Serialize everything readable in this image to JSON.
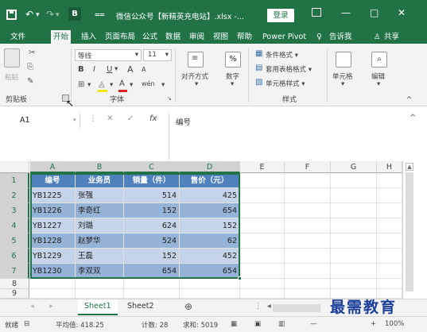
{
  "titlebar": {
    "undo_icon": "undo-icon",
    "redo_icon": "redo-icon",
    "app_badge": "B",
    "title": "微信公众号【新精英充电站】.xlsx -...",
    "login": "登录",
    "ribbon_opts_icon": "ribbon-display-icon",
    "minimize": "—",
    "maximize": "□",
    "close": "✕"
  },
  "tabs": {
    "items": [
      "文件",
      "开始",
      "插入",
      "页面布局",
      "公式",
      "数据",
      "审阅",
      "视图",
      "帮助",
      "Power Pivot"
    ],
    "active": "开始",
    "tell_me": "告诉我",
    "share": "共享"
  },
  "ribbon": {
    "clipboard": {
      "paste": "粘贴",
      "label": "剪贴板"
    },
    "font": {
      "name": "等线",
      "size": "11",
      "bold": "B",
      "italic": "I",
      "underline": "U",
      "grow": "A",
      "shrink": "A",
      "color_a": "A",
      "wen": "wén",
      "label": "字体"
    },
    "align": {
      "label": "对齐方式"
    },
    "number": {
      "symbol": "%",
      "label": "数字"
    },
    "styles": {
      "conditional": "条件格式 ▾",
      "table": "套用表格格式 ▾",
      "cell": "单元格样式 ▾",
      "label": "样式"
    },
    "cells": {
      "label": "单元格"
    },
    "editing": {
      "label": "编辑"
    }
  },
  "formula_bar": {
    "namebox": "A1",
    "cancel": "✕",
    "enter": "✓",
    "fx": "fx",
    "content": "编号"
  },
  "grid": {
    "columns": [
      "A",
      "B",
      "C",
      "D",
      "E",
      "F",
      "G",
      "H"
    ],
    "rows": [
      "1",
      "2",
      "3",
      "4",
      "5",
      "6",
      "7",
      "8",
      "9"
    ],
    "header": [
      "编号",
      "业务员",
      "销量（件）",
      "售价（元）"
    ],
    "data": [
      [
        "YB1225",
        "张强",
        "514",
        "425"
      ],
      [
        "YB1226",
        "李奇红",
        "152",
        "654"
      ],
      [
        "YB1227",
        "刘璐",
        "624",
        "152"
      ],
      [
        "YB1228",
        "赵梦华",
        "524",
        "62"
      ],
      [
        "YB1229",
        "王磊",
        "152",
        "452"
      ],
      [
        "YB1230",
        "李双双",
        "654",
        "654"
      ]
    ],
    "colors": {
      "header_bg": "#4f81bd",
      "band_dark": "#95b3d7",
      "band_light": "#c5d4e8",
      "selection_border": "#217346"
    }
  },
  "sheets": {
    "tabs": [
      "Sheet1",
      "Sheet2"
    ],
    "active": "Sheet1",
    "add": "⊕"
  },
  "status": {
    "ready": "就绪",
    "avg": "平均值: 418.25",
    "count": "计数: 28",
    "sum": "求和: 5019",
    "zoom": "100%",
    "zoom_minus": "—",
    "zoom_plus": "+"
  },
  "watermark": "最需教育"
}
